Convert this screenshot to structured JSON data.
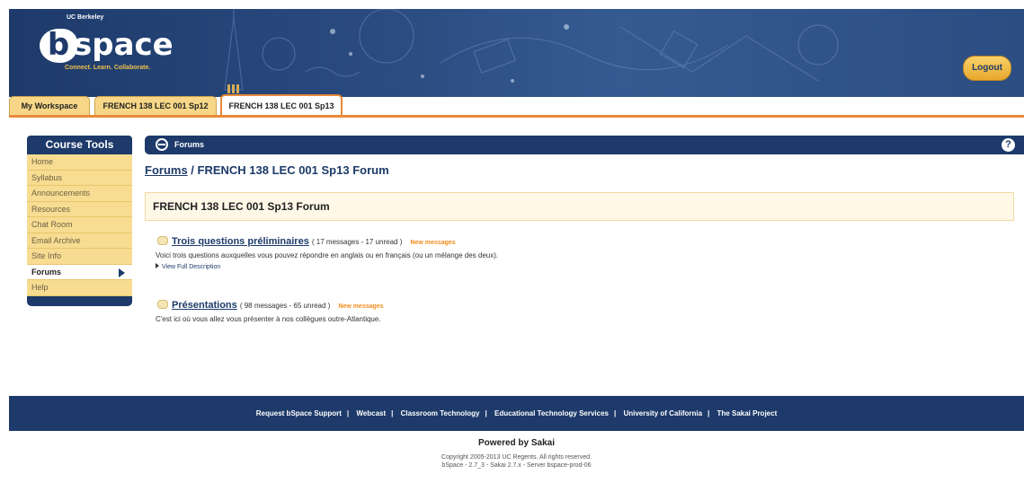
{
  "brand": {
    "institution": "UC Berkeley",
    "logo_b": "b",
    "logo_space": "space",
    "tagline": "Connect. Learn. Collaborate."
  },
  "header": {
    "logout_label": "Logout"
  },
  "tabs": [
    {
      "label": "My Workspace"
    },
    {
      "label": "FRENCH 138 LEC 001 Sp12"
    },
    {
      "label": "FRENCH 138 LEC 001 Sp13"
    }
  ],
  "sidebar": {
    "title": "Course Tools",
    "items": [
      {
        "label": "Home"
      },
      {
        "label": "Syllabus"
      },
      {
        "label": "Announcements"
      },
      {
        "label": "Resources"
      },
      {
        "label": "Chat Room"
      },
      {
        "label": "Email Archive"
      },
      {
        "label": "Site Info"
      },
      {
        "label": "Forums"
      },
      {
        "label": "Help"
      }
    ]
  },
  "tool": {
    "title": "Forums",
    "help_label": "?"
  },
  "breadcrumb": {
    "link": "Forums",
    "separator": " / ",
    "current": "FRENCH 138 LEC 001 Sp13 Forum"
  },
  "forum": {
    "title": "FRENCH 138 LEC 001 Sp13 Forum",
    "topics": [
      {
        "title": "Trois questions préliminaires",
        "meta": "( 17 messages - 17 unread )",
        "new_label": "New messages",
        "description": "Voici trois questions auxquelles vous pouvez répondre en anglais ou en français (ou un mélange des deux).",
        "view_full": "View Full Description"
      },
      {
        "title": "Présentations",
        "meta": "( 98 messages - 65 unread )",
        "new_label": "New messages",
        "description": "C'est ici où vous allez vous présenter à nos collègues outre-Atlantique."
      }
    ]
  },
  "footer": {
    "links": [
      "Request bSpace Support",
      "Webcast",
      "Classroom Technology",
      "Educational Technology Services",
      "University of California",
      "The Sakai Project"
    ],
    "separator": "|",
    "powered_by": "Powered by Sakai",
    "copyright": "Copyright 2005-2013 UC Regents. All rights reserved.",
    "version": "bSpace - 2.7_3 - Sakai 2.7.x - Server bspace-prod-06"
  }
}
